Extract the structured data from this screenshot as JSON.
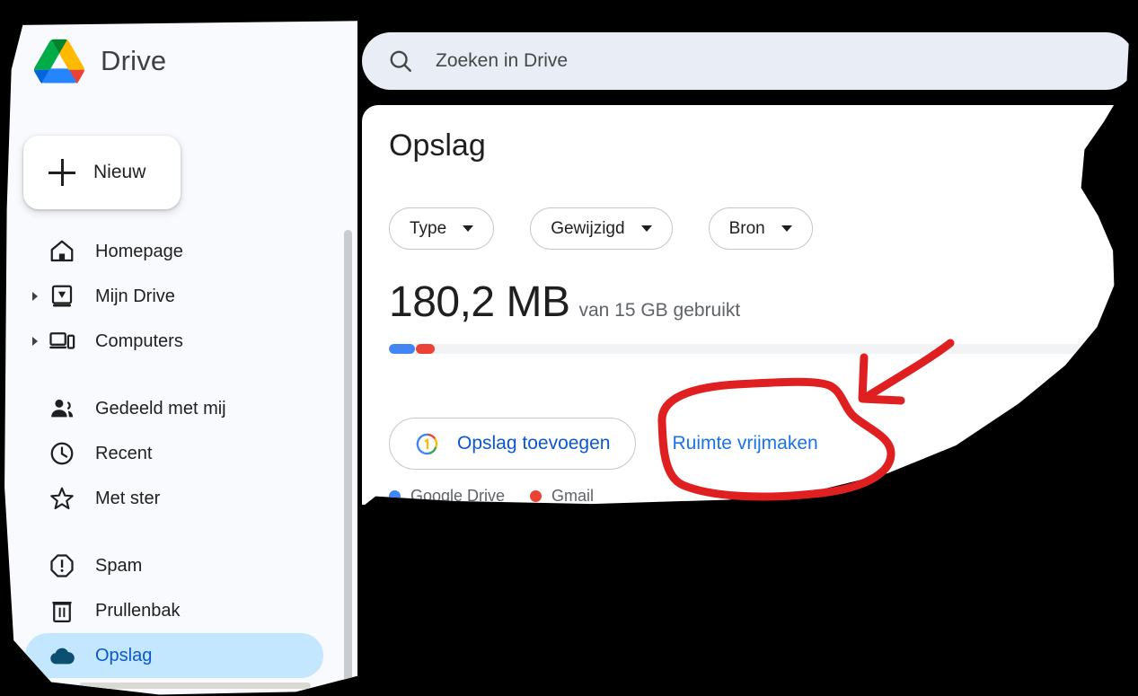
{
  "app": {
    "brand_name": "Drive",
    "logo_icon": "google-drive-logo"
  },
  "search": {
    "placeholder": "Zoeken in Drive",
    "icon": "search-icon"
  },
  "sidebar": {
    "new_button": {
      "label": "Nieuw",
      "icon": "plus-icon"
    },
    "groups": [
      {
        "items": [
          {
            "label": "Homepage",
            "icon": "home-icon",
            "expandable": false,
            "active": false
          },
          {
            "label": "Mijn Drive",
            "icon": "my-drive-icon",
            "expandable": true,
            "active": false
          },
          {
            "label": "Computers",
            "icon": "computers-icon",
            "expandable": true,
            "active": false
          }
        ]
      },
      {
        "items": [
          {
            "label": "Gedeeld met mij",
            "icon": "people-icon",
            "expandable": false,
            "active": false
          },
          {
            "label": "Recent",
            "icon": "clock-icon",
            "expandable": false,
            "active": false
          },
          {
            "label": "Met ster",
            "icon": "star-icon",
            "expandable": false,
            "active": false
          }
        ]
      },
      {
        "items": [
          {
            "label": "Spam",
            "icon": "spam-icon",
            "expandable": false,
            "active": false
          },
          {
            "label": "Prullenbak",
            "icon": "trash-icon",
            "expandable": false,
            "active": false
          },
          {
            "label": "Opslag",
            "icon": "cloud-icon",
            "expandable": false,
            "active": true
          }
        ]
      }
    ],
    "scrollbars": {
      "vertical": "sidebar-vertical-scrollbar",
      "horizontal": "sidebar-horizontal-scrollbar"
    }
  },
  "main": {
    "title": "Opslag",
    "filters": [
      {
        "label": "Type",
        "icon": "chevron-down-icon"
      },
      {
        "label": "Gewijzigd",
        "icon": "chevron-down-icon"
      },
      {
        "label": "Bron",
        "icon": "chevron-down-icon"
      }
    ],
    "storage": {
      "used_amount": "180,2 MB",
      "quota_text": "van 15 GB gebruikt",
      "segments": [
        {
          "name": "Google Drive",
          "color": "#4285f4",
          "percent": 3.6
        },
        {
          "name": "Gmail",
          "color": "#ea4335",
          "percent": 2.6
        }
      ],
      "track_color": "#f1f3f4"
    },
    "legend": [
      {
        "label": "Google Drive",
        "color": "#4285f4"
      },
      {
        "label": "Gmail",
        "color": "#ea4335"
      }
    ],
    "actions": {
      "add_storage": {
        "label": "Opslag toevoegen",
        "icon": "google-one-icon"
      },
      "free_space": {
        "label": "Ruimte vrijmaken"
      }
    }
  },
  "annotation": {
    "color": "#e02020",
    "shapes": [
      "circle-highlight-around-free-space-link",
      "arrow-pointing-to-free-space-link"
    ]
  }
}
